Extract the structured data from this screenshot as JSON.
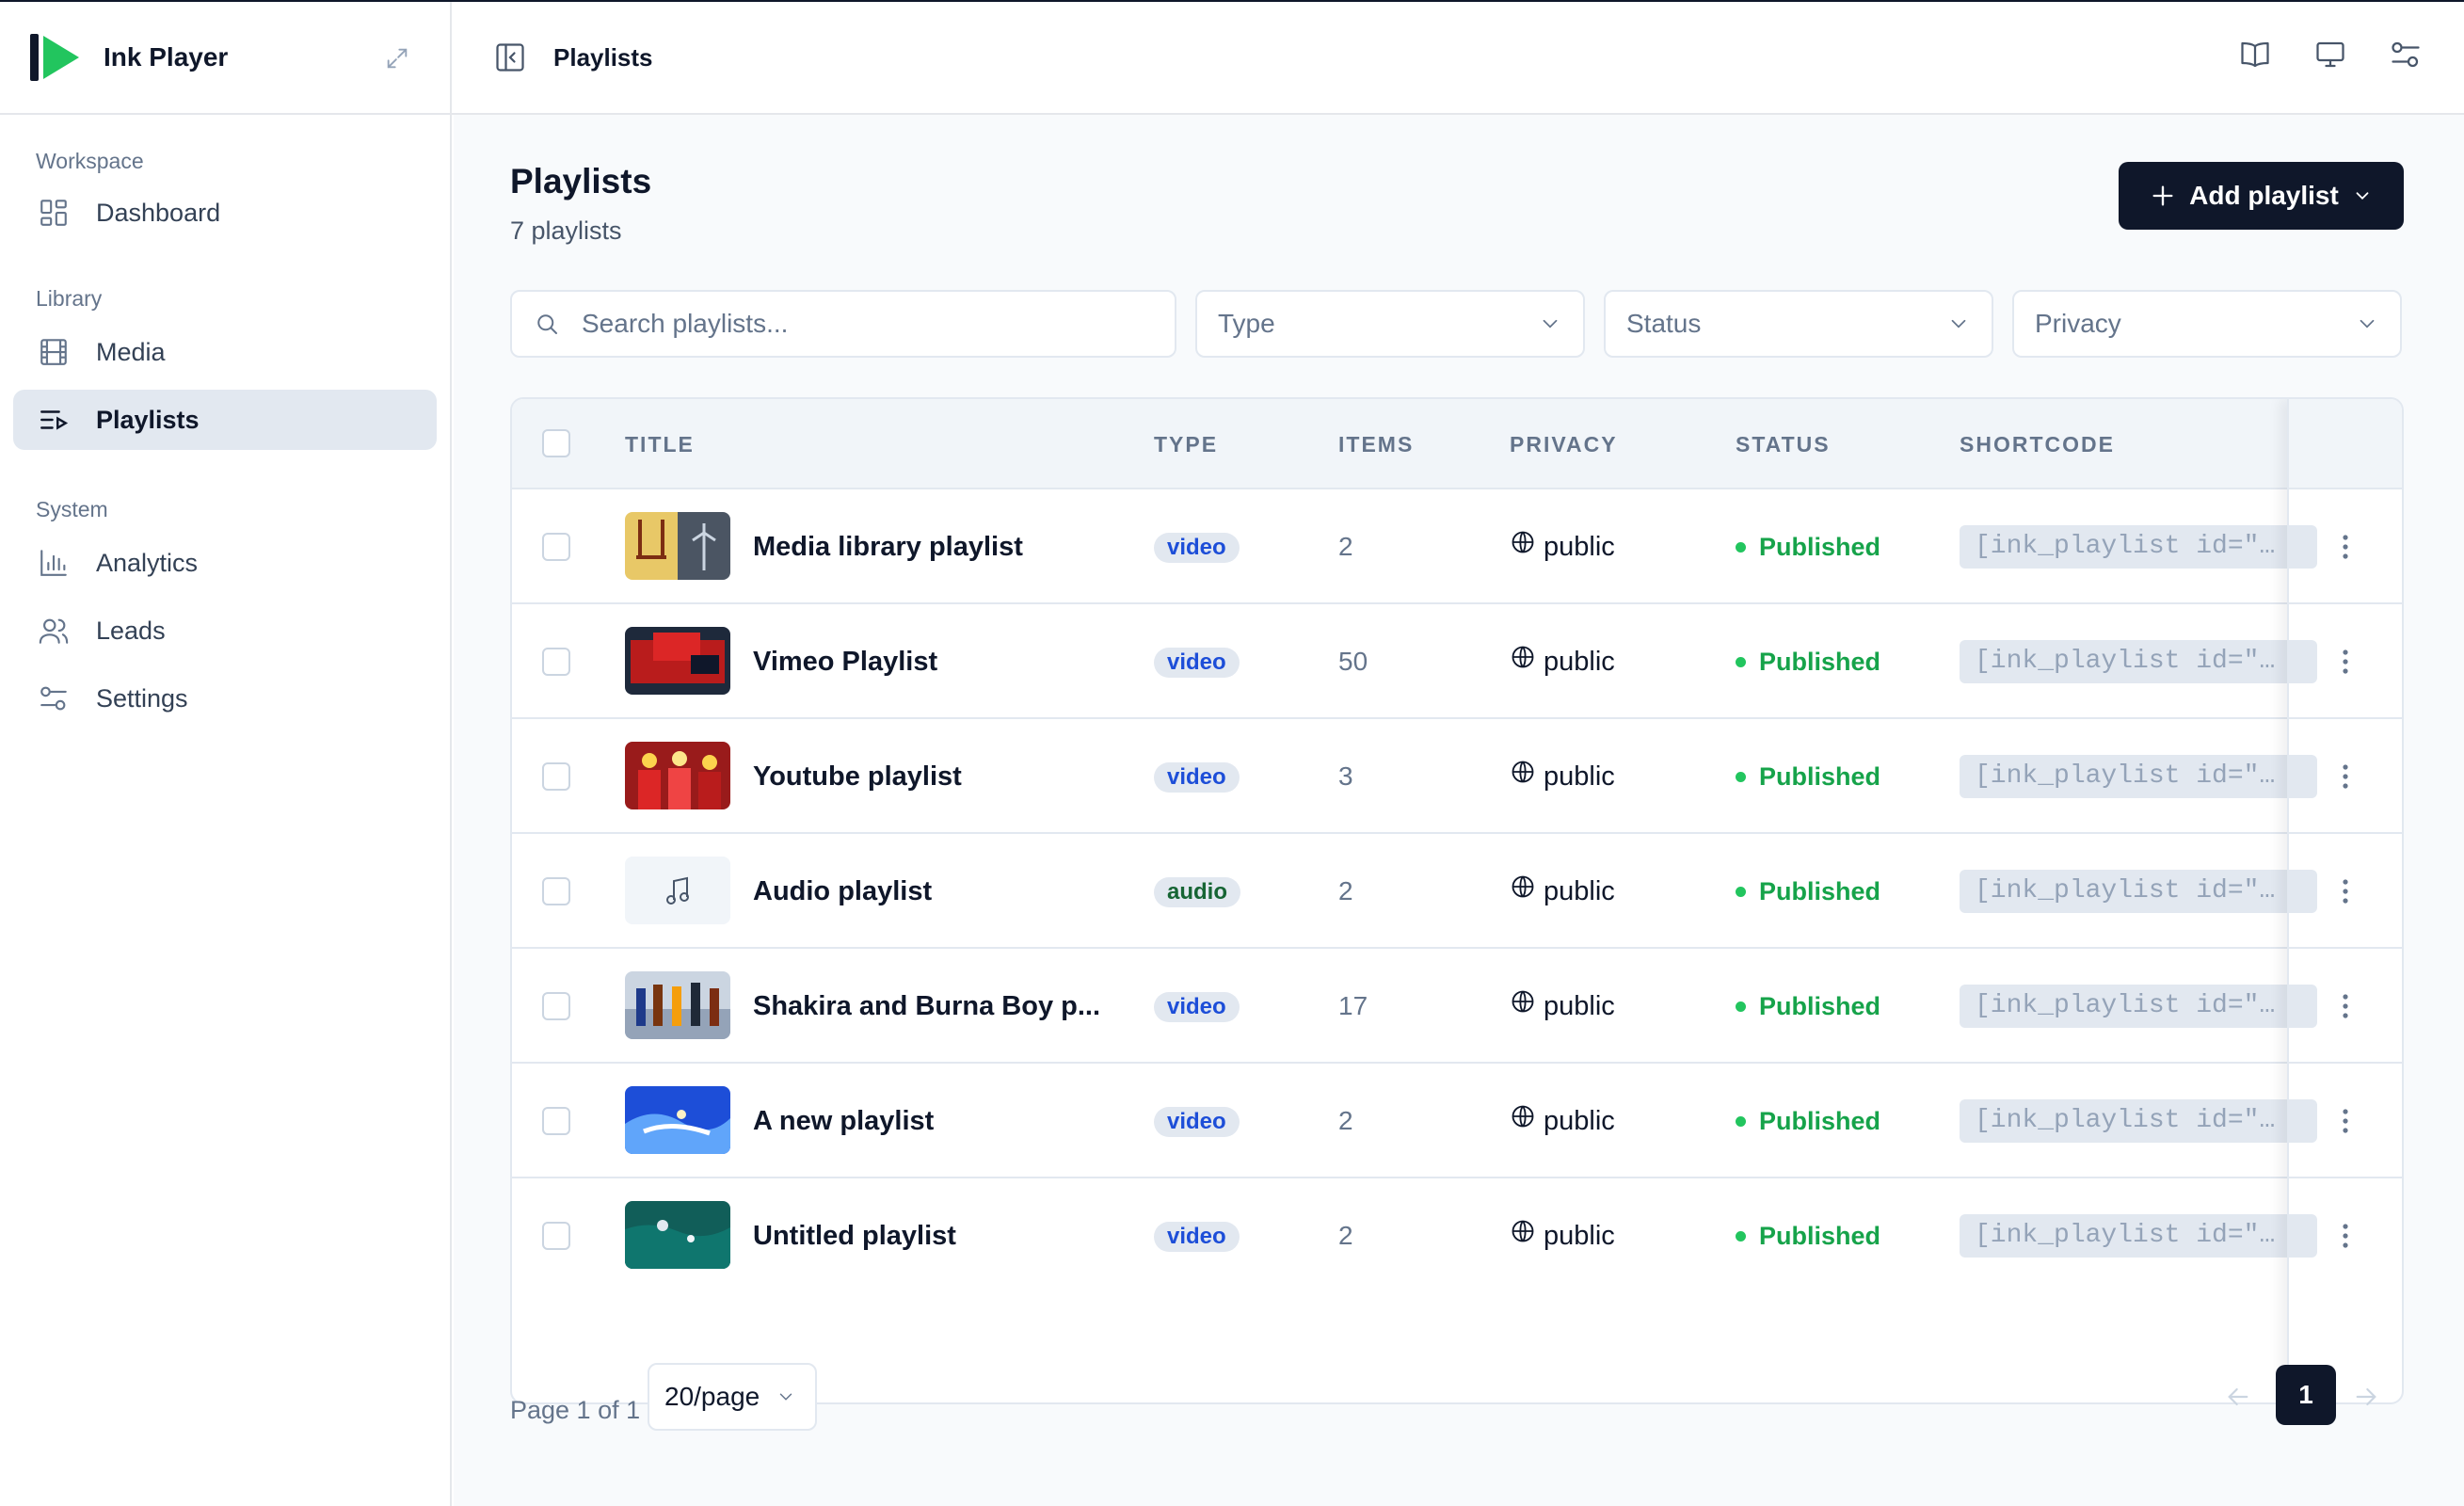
{
  "app": {
    "name": "Ink Player"
  },
  "colors": {
    "accent": "#0f172a",
    "brand_green": "#22c55e",
    "published": "#16a34a"
  },
  "topbar": {
    "breadcrumb": "Playlists"
  },
  "sidebar": {
    "sections": [
      {
        "heading": "Workspace",
        "items": [
          {
            "label": "Dashboard",
            "icon": "dashboard-icon"
          }
        ]
      },
      {
        "heading": "Library",
        "items": [
          {
            "label": "Media",
            "icon": "film-icon"
          },
          {
            "label": "Playlists",
            "icon": "playlist-icon",
            "active": true
          }
        ]
      },
      {
        "heading": "System",
        "items": [
          {
            "label": "Analytics",
            "icon": "bar-chart-icon"
          },
          {
            "label": "Leads",
            "icon": "users-icon"
          },
          {
            "label": "Settings",
            "icon": "sliders-icon"
          }
        ]
      }
    ]
  },
  "page": {
    "title": "Playlists",
    "subtitle": "7 playlists",
    "add_button": "Add playlist"
  },
  "filters": {
    "search_placeholder": "Search playlists...",
    "type": "Type",
    "status": "Status",
    "privacy": "Privacy"
  },
  "table": {
    "columns": [
      "TITLE",
      "TYPE",
      "ITEMS",
      "PRIVACY",
      "STATUS",
      "SHORTCODE"
    ],
    "rows": [
      {
        "title": "Media library playlist",
        "type": "video",
        "items": "2",
        "privacy": "public",
        "status": "Published",
        "shortcode": "[ink_playlist id=\"…",
        "thumb": "yellow-swing"
      },
      {
        "title": "Vimeo Playlist",
        "type": "video",
        "items": "50",
        "privacy": "public",
        "status": "Published",
        "shortcode": "[ink_playlist id=\"…",
        "thumb": "red-street"
      },
      {
        "title": "Youtube playlist",
        "type": "video",
        "items": "3",
        "privacy": "public",
        "status": "Published",
        "shortcode": "[ink_playlist id=\"…",
        "thumb": "red-crowd"
      },
      {
        "title": "Audio playlist",
        "type": "audio",
        "items": "2",
        "privacy": "public",
        "status": "Published",
        "shortcode": "[ink_playlist id=\"…",
        "thumb": "music-note"
      },
      {
        "title": "Shakira and Burna Boy p...",
        "type": "video",
        "items": "17",
        "privacy": "public",
        "status": "Published",
        "shortcode": "[ink_playlist id=\"…",
        "thumb": "dancers"
      },
      {
        "title": "A new playlist",
        "type": "video",
        "items": "2",
        "privacy": "public",
        "status": "Published",
        "shortcode": "[ink_playlist id=\"…",
        "thumb": "surfer"
      },
      {
        "title": "Untitled playlist",
        "type": "video",
        "items": "2",
        "privacy": "public",
        "status": "Published",
        "shortcode": "[ink_playlist id=\"…",
        "thumb": "ocean"
      }
    ]
  },
  "pagination": {
    "label": "Page 1 of 1",
    "per_page": "20/page",
    "current_page": "1"
  }
}
